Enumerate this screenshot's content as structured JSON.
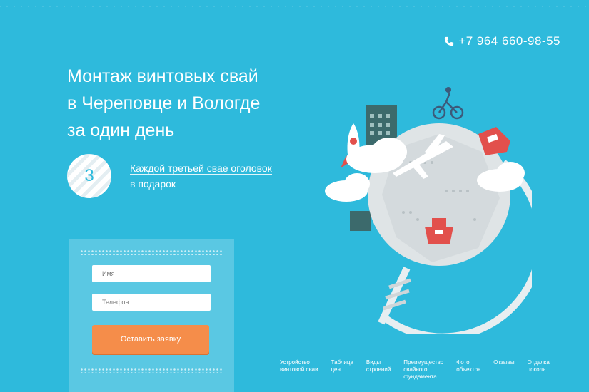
{
  "header": {
    "phone": "+7 964 660-98-55",
    "phone_icon": "phone-icon"
  },
  "hero": {
    "headline_line1": "Монтаж винтовых свай",
    "headline_line2": "в Череповце и Вологде",
    "headline_line3": "за один день"
  },
  "promo": {
    "badge_number": "3",
    "text_line1": "Каждой третьей свае оголовок",
    "text_line2": "в подарок"
  },
  "form": {
    "name_placeholder": "Имя",
    "phone_placeholder": "Телефон",
    "submit_label": "Оставить заявку"
  },
  "footer_nav": [
    {
      "line1": "Устройство",
      "line2": "винтовой сваи"
    },
    {
      "line1": "Таблица",
      "line2": "цен"
    },
    {
      "line1": "Виды",
      "line2": "строений"
    },
    {
      "line1": "Преимущество",
      "line2": "свайного",
      "line3": "фундамента"
    },
    {
      "line1": "Фото",
      "line2": "объектов"
    },
    {
      "line1": "Отзывы"
    },
    {
      "line1": "Отделка",
      "line2": "цоколя"
    }
  ],
  "colors": {
    "background": "#2ebadc",
    "button": "#f58d4a",
    "form_bg": "#5ac8e3"
  }
}
